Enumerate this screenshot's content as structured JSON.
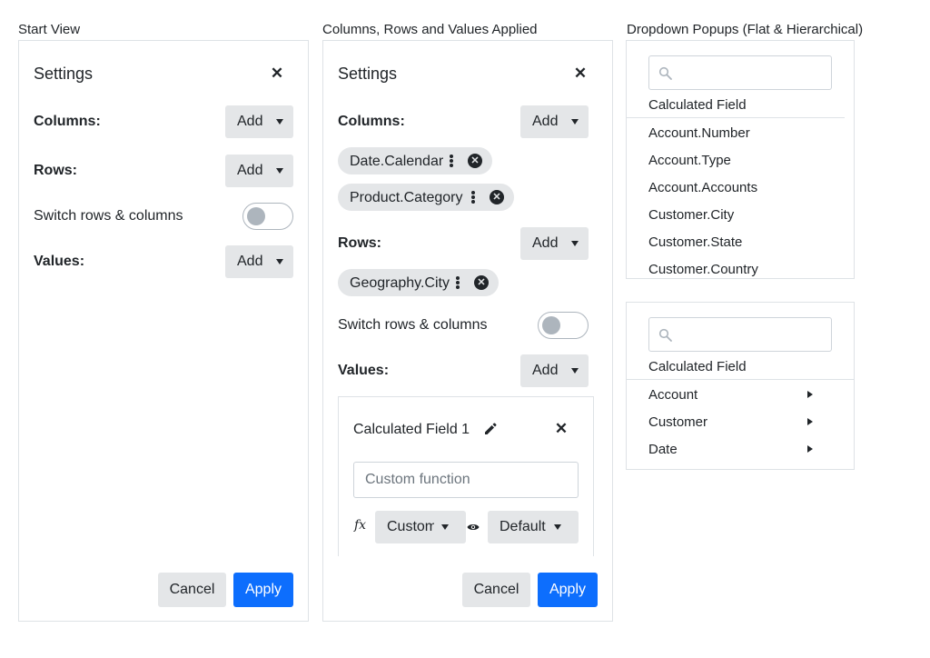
{
  "captions": {
    "start": "Start View",
    "applied": "Columns, Rows and Values Applied",
    "dropdown": "Dropdown Popups (Flat & Hierarchical)"
  },
  "start_panel": {
    "title": "Settings",
    "columns_label": "Columns:",
    "rows_label": "Rows:",
    "switch_label": "Switch rows & columns",
    "switch_on": false,
    "values_label": "Values:",
    "add_label": "Add",
    "cancel_label": "Cancel",
    "apply_label": "Apply"
  },
  "applied_panel": {
    "title": "Settings",
    "columns_label": "Columns:",
    "column_chips": [
      "Date.Calendar",
      "Product.Category"
    ],
    "rows_label": "Rows:",
    "row_chips": [
      "Geography.City"
    ],
    "switch_label": "Switch rows & columns",
    "switch_on": false,
    "values_label": "Values:",
    "add_label": "Add",
    "calc_field": {
      "name": "Calculated Field 1",
      "function_placeholder": "Custom function",
      "fx_symbol": "fx",
      "aggregate_value": "Custom",
      "format_value": "Default"
    },
    "cancel_label": "Cancel",
    "apply_label": "Apply"
  },
  "flat_popup": {
    "search_placeholder": "",
    "header_item": "Calculated Field",
    "items": [
      "Account.Number",
      "Account.Type",
      "Account.Accounts",
      "Customer.City",
      "Customer.State",
      "Customer.Country"
    ]
  },
  "hier_popup": {
    "search_placeholder": "",
    "header_item": "Calculated Field",
    "items": [
      "Account",
      "Customer",
      "Date"
    ]
  },
  "colors": {
    "accent": "#0d6efd",
    "button_gray": "#e4e6e8",
    "border": "#dee2e6",
    "toggle_gray": "#adb5bd"
  }
}
